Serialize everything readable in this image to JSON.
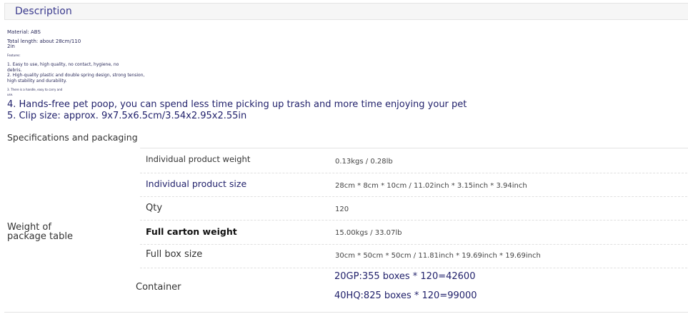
{
  "description": {
    "title": "Description",
    "lines": {
      "material": "Material: ABS",
      "length1": "Total length: about 28cm/110",
      "length2": "2in",
      "features": "Features:",
      "f1a": "1. Easy to use, high quality, no contact, hygiene, no",
      "f1b": "debris.",
      "f2a": "2. High-quality plastic and double spring design, strong tension,",
      "f2b": "high stability and durability.",
      "f3a": "3. There is a handle, easy to carry and",
      "f3b": "use.",
      "f4": "4. Hands-free pet poop, you can spend less time picking up trash and more time enjoying your pet",
      "f5": "5. Clip size: approx. 9x7.5x6.5cm/3.54x2.95x2.55in"
    }
  },
  "specs": {
    "title": "Specifications and packaging",
    "row_label": "Weight of package table",
    "rows": [
      {
        "key": "Individual product weight",
        "value": "0.13kgs / 0.28lb"
      },
      {
        "key": "Individual product size",
        "value": "28cm * 8cm * 10cm / 11.02inch * 3.15inch * 3.94inch"
      },
      {
        "key": "Qty",
        "value": "120"
      },
      {
        "key": "Full carton weight",
        "value": "15.00kgs / 33.07lb"
      },
      {
        "key": "Full box size",
        "value": "30cm * 50cm * 50cm / 11.81inch * 19.69inch * 19.69inch"
      }
    ],
    "container": {
      "key": "Container",
      "values": [
        "20GP:355 boxes * 120=42600",
        "40HQ:825 boxes * 120=99000"
      ]
    }
  }
}
